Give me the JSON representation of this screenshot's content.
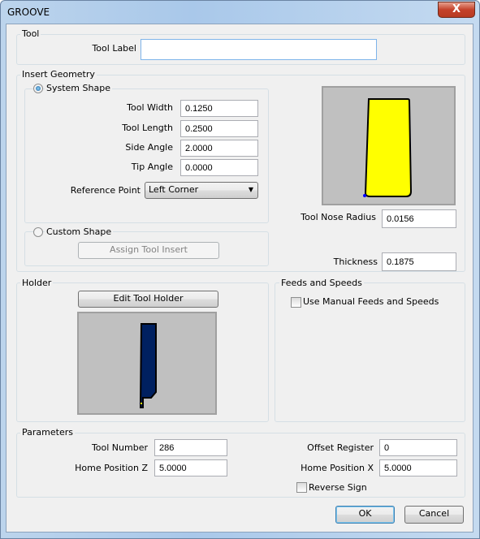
{
  "window": {
    "title": "GROOVE",
    "close_label": "X"
  },
  "tool": {
    "group": "Tool",
    "label": "Tool Label",
    "value": ""
  },
  "insert": {
    "group": "Insert Geometry",
    "system_shape": "System Shape",
    "system_selected": true,
    "tool_width_label": "Tool Width",
    "tool_width": "0.1250",
    "tool_length_label": "Tool Length",
    "tool_length": "0.2500",
    "side_angle_label": "Side Angle",
    "side_angle": "2.0000",
    "tip_angle_label": "Tip Angle",
    "tip_angle": "0.0000",
    "ref_point_label": "Reference Point",
    "ref_point": "Left Corner",
    "custom_shape": "Custom Shape",
    "assign_button": "Assign Tool Insert",
    "nose_radius_label": "Tool Nose Radius",
    "nose_radius": "0.0156",
    "thickness_label": "Thickness",
    "thickness": "0.1875",
    "insert_color": "#ffff00"
  },
  "holder": {
    "group": "Holder",
    "edit_button": "Edit Tool Holder",
    "holder_color": "#002060"
  },
  "feeds": {
    "group": "Feeds and Speeds",
    "manual_label": "Use Manual Feeds and Speeds",
    "manual_checked": false
  },
  "params": {
    "group": "Parameters",
    "tool_number_label": "Tool Number",
    "tool_number": "286",
    "home_z_label": "Home Position Z",
    "home_z": "5.0000",
    "offset_label": "Offset Register",
    "offset": "0",
    "home_x_label": "Home Position X",
    "home_x": "5.0000",
    "reverse_label": "Reverse Sign",
    "reverse_checked": false
  },
  "buttons": {
    "ok": "OK",
    "cancel": "Cancel"
  }
}
